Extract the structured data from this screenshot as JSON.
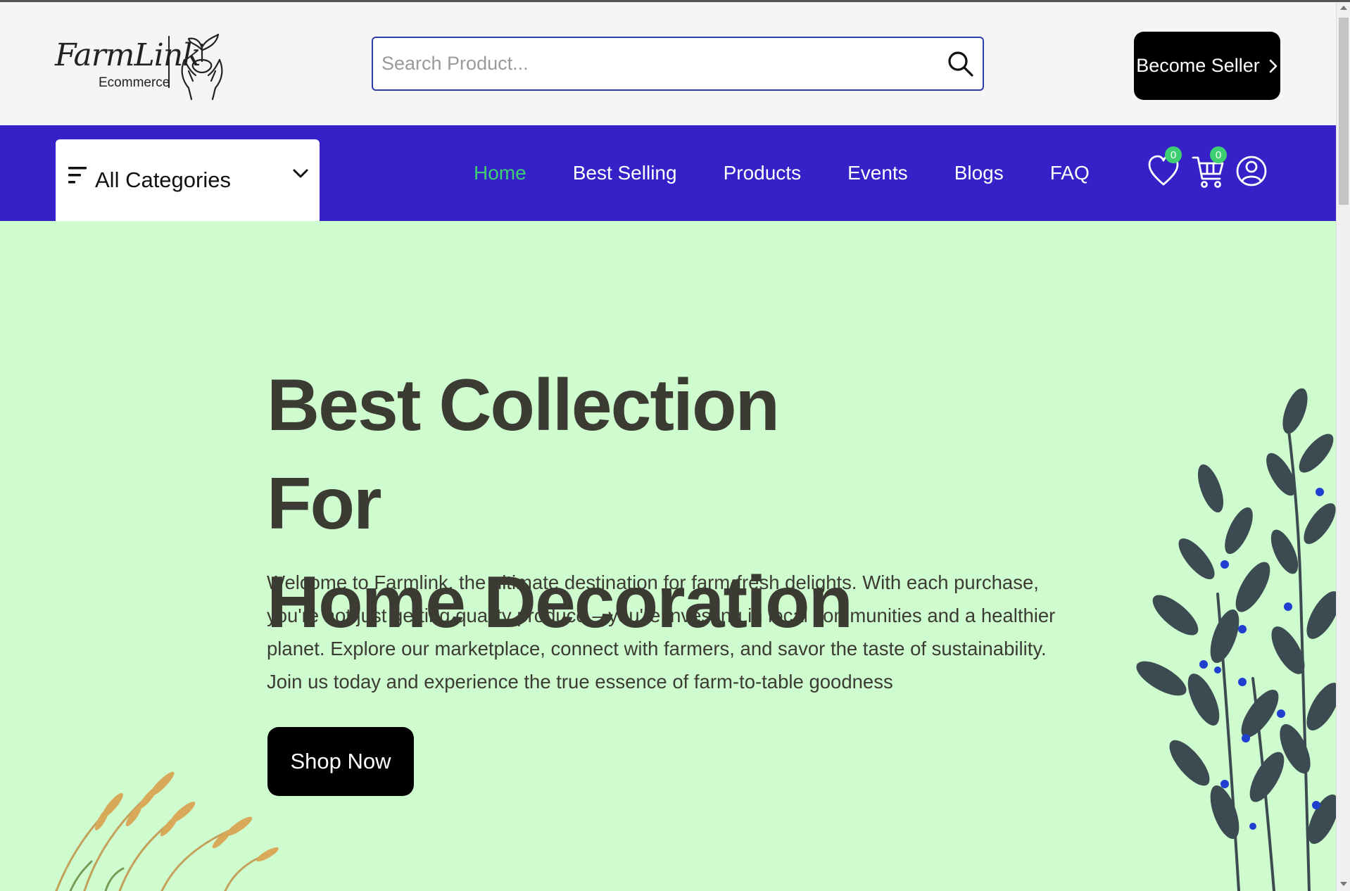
{
  "header": {
    "logo": {
      "script_text": "FarmLink",
      "sub_text": "Ecommerce"
    },
    "search": {
      "placeholder": "Search Product...",
      "value": ""
    },
    "seller_button": {
      "label": "Become Seller"
    }
  },
  "nav": {
    "categories": {
      "label": "All Categories"
    },
    "links": [
      {
        "label": "Home",
        "active": true
      },
      {
        "label": "Best Selling",
        "active": false
      },
      {
        "label": "Products",
        "active": false
      },
      {
        "label": "Events",
        "active": false
      },
      {
        "label": "Blogs",
        "active": false
      },
      {
        "label": "FAQ",
        "active": false
      }
    ],
    "wishlist": {
      "icon": "heart-icon",
      "count": "0"
    },
    "cart": {
      "icon": "cart-icon",
      "count": "0"
    },
    "profile": {
      "icon": "user-circle-icon"
    }
  },
  "hero": {
    "title_line1": "Best Collection For",
    "title_line2": "Home Decoration",
    "text": "Welcome to Farmlink, the ultimate destination for farm-fresh delights. With each purchase, you're not just getting quality produce – you're investing in local communities and a healthier planet. Explore our marketplace, connect with farmers, and savor the taste of sustainability. Join us today and experience the true essence of farm-to-table goodness",
    "button": "Shop Now"
  },
  "colors": {
    "nav_bg": "#3620c7",
    "active_link": "#3ecf72",
    "hero_bg": "#cffccf",
    "badge": "#3ecf72"
  }
}
